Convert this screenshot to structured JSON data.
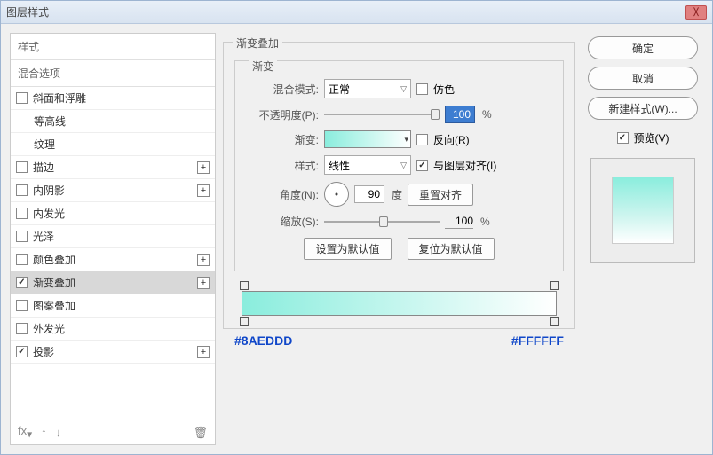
{
  "dialog": {
    "title": "图层样式"
  },
  "left": {
    "header_styles": "样式",
    "header_blend": "混合选项",
    "items": [
      {
        "label": "斜面和浮雕",
        "checked": false,
        "plus": false,
        "sub": false
      },
      {
        "label": "等高线",
        "checked": false,
        "plus": false,
        "sub": true,
        "nocb": true
      },
      {
        "label": "纹理",
        "checked": false,
        "plus": false,
        "sub": true,
        "nocb": true
      },
      {
        "label": "描边",
        "checked": false,
        "plus": true,
        "sub": false
      },
      {
        "label": "内阴影",
        "checked": false,
        "plus": true,
        "sub": false
      },
      {
        "label": "内发光",
        "checked": false,
        "plus": false,
        "sub": false
      },
      {
        "label": "光泽",
        "checked": false,
        "plus": false,
        "sub": false
      },
      {
        "label": "颜色叠加",
        "checked": false,
        "plus": true,
        "sub": false
      },
      {
        "label": "渐变叠加",
        "checked": true,
        "plus": true,
        "sub": false,
        "selected": true
      },
      {
        "label": "图案叠加",
        "checked": false,
        "plus": false,
        "sub": false
      },
      {
        "label": "外发光",
        "checked": false,
        "plus": false,
        "sub": false
      },
      {
        "label": "投影",
        "checked": true,
        "plus": true,
        "sub": false
      }
    ],
    "footer_fx": "fx"
  },
  "center": {
    "group_title": "渐变叠加",
    "subgroup_title": "渐变",
    "blend_label": "混合模式:",
    "blend_value": "正常",
    "dither_label": "仿色",
    "opacity_label": "不透明度(P):",
    "opacity_value": "100",
    "opacity_unit": "%",
    "gradient_label": "渐变:",
    "reverse_label": "反向(R)",
    "style_label": "样式:",
    "style_value": "线性",
    "align_label": "与图层对齐(I)",
    "angle_label": "角度(N):",
    "angle_value": "90",
    "angle_unit": "度",
    "reset_align_btn": "重置对齐",
    "scale_label": "缩放(S):",
    "scale_value": "100",
    "scale_unit": "%",
    "set_default_btn": "设置为默认值",
    "reset_default_btn": "复位为默认值",
    "hex_left": "#8AEDDD",
    "hex_right": "#FFFFFF"
  },
  "right": {
    "ok": "确定",
    "cancel": "取消",
    "new_style": "新建样式(W)...",
    "preview_label": "预览(V)"
  }
}
